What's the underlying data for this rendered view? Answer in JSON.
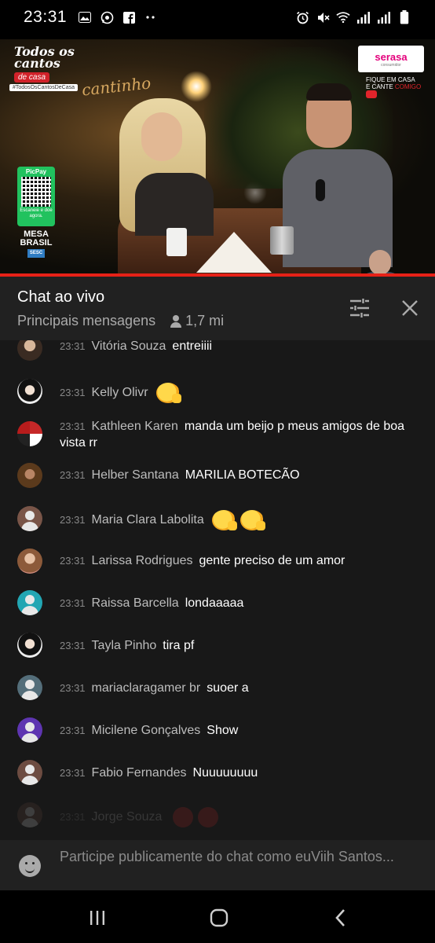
{
  "status_bar": {
    "time": "23:31",
    "left_icons": [
      "gallery-icon",
      "whatsapp-icon",
      "facebook-icon",
      "more-dots-icon"
    ],
    "right_icons": [
      "alarm-icon",
      "mute-icon",
      "wifi-icon",
      "signal-icon",
      "signal-icon",
      "battery-icon"
    ]
  },
  "video": {
    "logo_line1": "Todos os cantos",
    "logo_line2": "de casa",
    "hashtag": "#TodosOsCantosDeCasa",
    "cantinho": "cantinho",
    "sponsor": "serasa",
    "sponsor_sub": "consumidor",
    "fique_line1": "FIQUE EM CASA",
    "fique_line2": "E CANTE",
    "fique_red": "COMIGO",
    "picpay_label": "PicPay",
    "picpay_text": "Escaneie e doe agora.",
    "mesa_brasil": "MESA BRASIL",
    "sesc": "SESC"
  },
  "chat_header": {
    "title": "Chat ao vivo",
    "mode": "Principais mensagens",
    "viewers": "1,7 mi"
  },
  "messages": [
    {
      "time": "23:31",
      "author": "Vitória Souza",
      "text": "entreiiii",
      "avatar": "photo"
    },
    {
      "time": "23:31",
      "author": "Kelly Olivr",
      "text": "",
      "emoji": "smiling-face-emoji",
      "avatar": "photo"
    },
    {
      "time": "23:31",
      "author": "Kathleen Karen",
      "text": "manda um beijo p meus amigos de boa vista rr",
      "avatar": "photo"
    },
    {
      "time": "23:31",
      "author": "Helber Santana",
      "text": "MARILIA BOTECÃO",
      "avatar": "photo"
    },
    {
      "time": "23:31",
      "author": "Maria Clara Labolita",
      "text": "",
      "emoji": "smiling-face-emoji",
      "avatar": "default"
    },
    {
      "time": "23:31",
      "author": "Larissa Rodrigues",
      "text": "gente preciso de um amor",
      "avatar": "photo"
    },
    {
      "time": "23:31",
      "author": "Raissa Barcella",
      "text": "londaaaaa",
      "avatar": "default"
    },
    {
      "time": "23:31",
      "author": "Tayla Pinho",
      "text": "tira pf",
      "avatar": "photo"
    },
    {
      "time": "23:31",
      "author": "mariaclaragamer br",
      "text": "suoer a",
      "avatar": "default"
    },
    {
      "time": "23:31",
      "author": "Micilene Gonçalves",
      "text": "Show",
      "avatar": "default"
    },
    {
      "time": "23:31",
      "author": "Fabio Fernandes",
      "text": "Nuuuuuuuu",
      "avatar": "default"
    },
    {
      "time": "23:31",
      "author": "Jorge Souza",
      "text": "",
      "emoji": "heart-emoji",
      "avatar": "default"
    }
  ],
  "avatar_colors": {
    "raissa": "#22a6b3",
    "mariaclaragamer": "#546e7a",
    "micilene": "#5e35b1",
    "maria_clara": "#795548",
    "fabio": "#6d4c41",
    "jorge": "#6d4c41"
  },
  "input": {
    "placeholder": "Participe publicamente do chat como euViih Santos..."
  },
  "colors": {
    "accent_red": "#e62117",
    "chat_bg": "#181818",
    "header_bg": "#212121"
  }
}
